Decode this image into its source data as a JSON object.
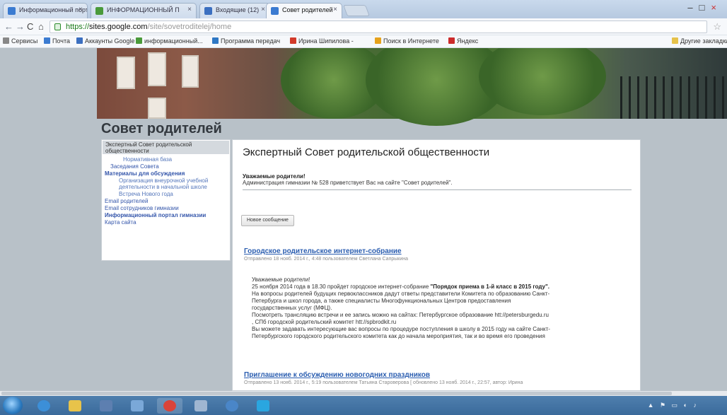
{
  "browser": {
    "tabs": [
      {
        "label": "Информационный порт",
        "color": "#3b7bd1"
      },
      {
        "label": "ИНФОРМАЦИОННЫЙ П",
        "color": "#4a9a3a"
      },
      {
        "label": "Входящие (12)",
        "color": "#3b6fc0"
      },
      {
        "label": "Совет родителей",
        "color": "#3b7bd1"
      }
    ],
    "url_scheme": "https://",
    "url_host": "sites.google.com",
    "url_path": "/site/sovetroditelej/home",
    "bookmarks": [
      {
        "label": "Сервисы",
        "color": "#777777"
      },
      {
        "label": "Почта",
        "color": "#3b7bd1"
      },
      {
        "label": "Аккаунты Google",
        "color": "#3b6fc0"
      },
      {
        "label": "информационный...",
        "color": "#4a9a3a"
      },
      {
        "label": "Программа передач",
        "color": "#2f78c4"
      },
      {
        "label": "Ирина Шипилова -",
        "color": "#d23a2a"
      },
      {
        "label": "Поиск в Интернете",
        "color": "#e6a21c"
      },
      {
        "label": "Яндекс",
        "color": "#cc2b2b"
      },
      {
        "label": "Другие закладки",
        "color": "#e6c24a"
      }
    ]
  },
  "site": {
    "title": "Совет родителей"
  },
  "sidebar": {
    "items": [
      {
        "label": "Экспертный Совет родительской",
        "style": "sel"
      },
      {
        "label": "общественности",
        "style": "sel"
      },
      {
        "label": "Нормативная база",
        "style": "sub"
      },
      {
        "label": "Заседания Совета",
        "style": "normal"
      },
      {
        "label": "Материалы для обсуждения",
        "style": "bold"
      },
      {
        "label": "Организация внеурочной учебной",
        "style": "sub"
      },
      {
        "label": "деятельности в начальной школе",
        "style": "sub"
      },
      {
        "label": "Встреча Нового года",
        "style": "sub"
      },
      {
        "label": "Email родителей",
        "style": "normal"
      },
      {
        "label": "Email сотрудников гимназии",
        "style": "normal"
      },
      {
        "label": "Информационный портал гимназии",
        "style": "bold"
      },
      {
        "label": "Карта сайта",
        "style": "normal"
      }
    ]
  },
  "main": {
    "title": "Экспертный Совет родительской общественности",
    "greeting_bold": "Уважаемые родители!",
    "greeting": "Администрация гимназии № 528 приветствует Вас на сайте \"Совет родителей\".",
    "new_message_button": "Новое сообщение",
    "posts": [
      {
        "title": "Городское родительское интернет-собрание",
        "meta": "Отправлено 18 нояб. 2014 г., 4:48 пользователем Светлана Сапрыкина"
      },
      {
        "title": "Приглашение к обсуждению новогодних праздников",
        "meta": "Отправлено 13 нояб. 2014 г., 5:19 пользователем Татьяна Староверова [ обновлено 13 нояб. 2014 г., 22:57, автор: Ирина"
      }
    ],
    "post_body": {
      "l1": "Уважаемые родители!",
      "l2a": "25 ноября 2014 года в 18.30 пройдет городское интернет-собрание ",
      "l2b": "\"Порядок приема в 1-й класс в 2015 году\".",
      "l3": "На вопросы родителей будущих первоклассников дадут ответы представители Комитета по образованию Санкт-",
      "l4": "Петербурга и школ города, а также специалисты Многофункциональных Центров предоставления",
      "l5": "государственных услуг (МФЦ).",
      "l6": "Посмотреть трансляцию встречи и ее запись можно на сайтах: Петербургское образование  htt://petersburgedu.ru",
      "l7": ", СПб городской родительский комитет htt://spbrodkit.ru",
      "l8": "Вы можете задавать интересующие вас вопросы по процедуре поступления в школу в 2015 году на сайте Санкт-",
      "l9": "Петербургского городского родительского комитета как до начала мероприятия, так и во время его проведения"
    }
  },
  "taskbar": {
    "apps": [
      {
        "name": "ie",
        "color": "#3c8fd8"
      },
      {
        "name": "explorer",
        "color": "#e8c34a"
      },
      {
        "name": "mail",
        "color": "#5d7fb0"
      },
      {
        "name": "app",
        "color": "#7aa8d8"
      },
      {
        "name": "chrome",
        "color": "#d9443a"
      },
      {
        "name": "calc",
        "color": "#9fb6d1"
      },
      {
        "name": "app2",
        "color": "#4a86c8"
      },
      {
        "name": "skype",
        "color": "#2aa6e0"
      }
    ]
  }
}
